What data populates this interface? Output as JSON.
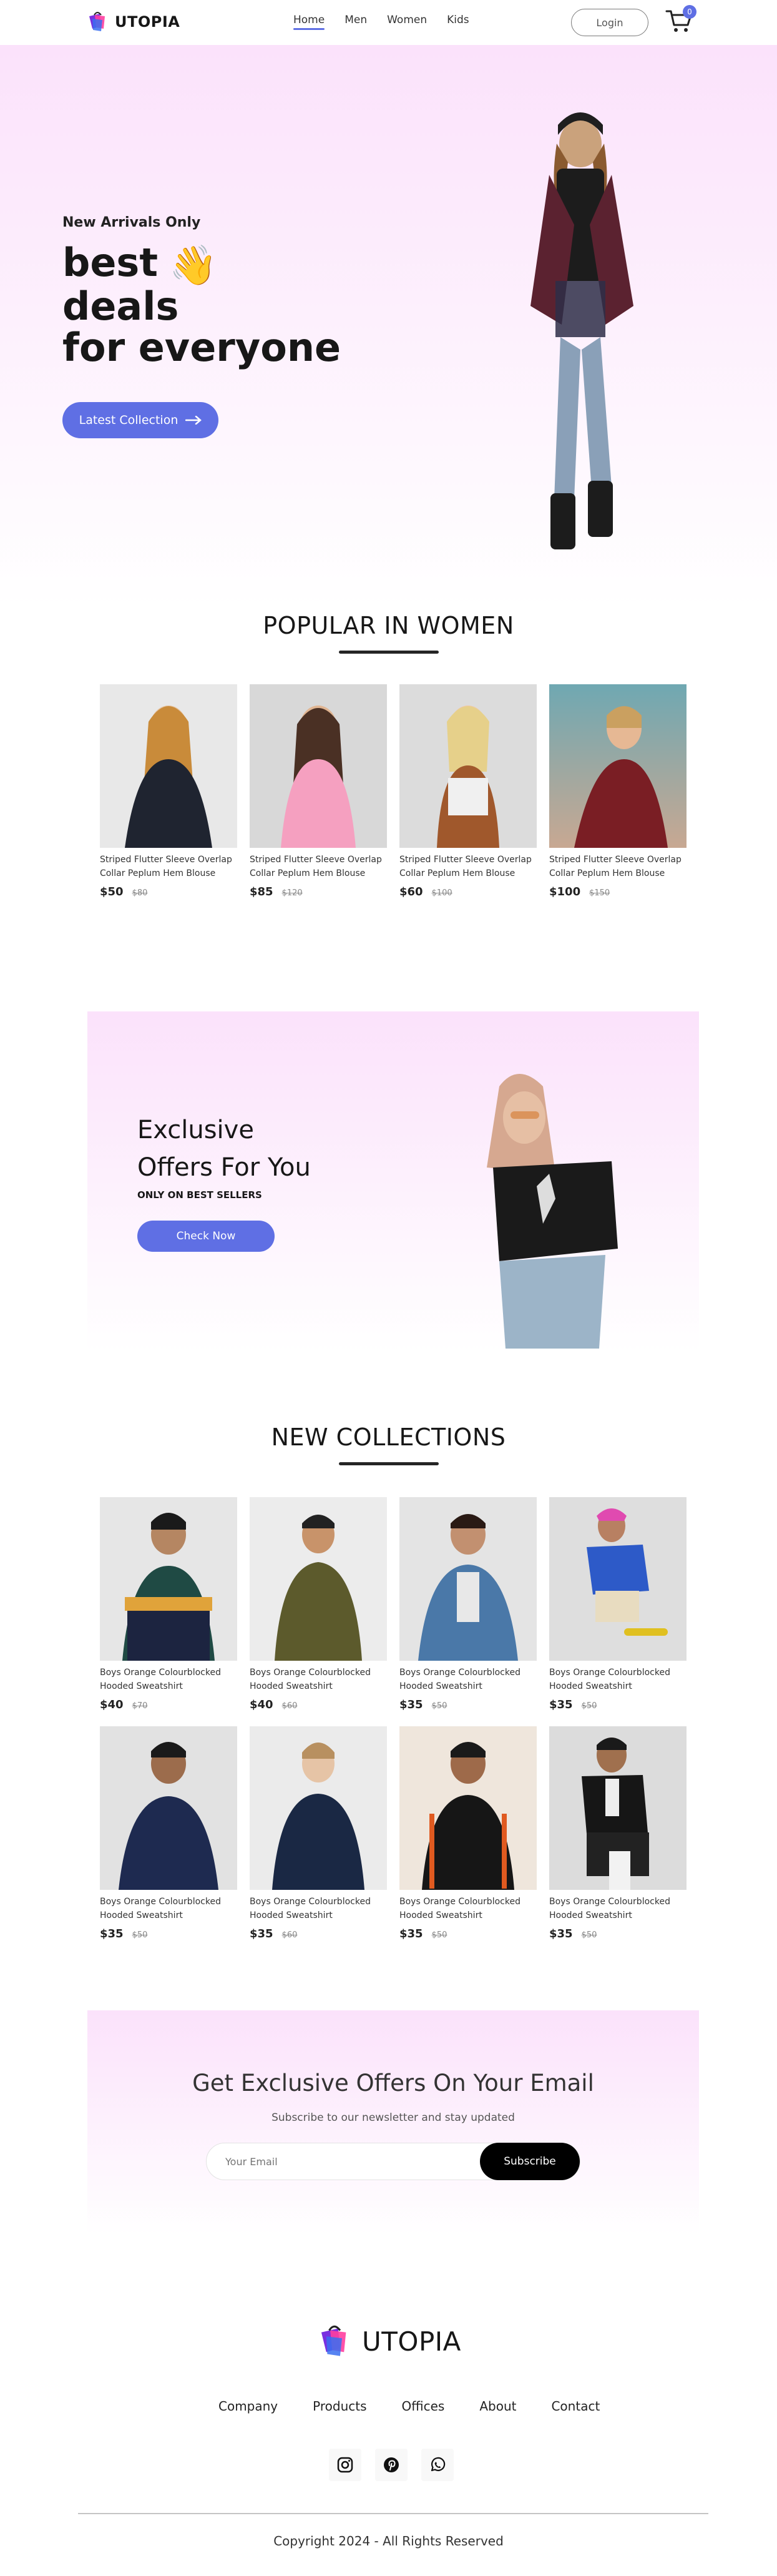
{
  "brand": {
    "name": "UTOPIA"
  },
  "nav": {
    "items": [
      {
        "label": "Home",
        "active": true
      },
      {
        "label": "Men",
        "active": false
      },
      {
        "label": "Women",
        "active": false
      },
      {
        "label": "Kids",
        "active": false
      }
    ],
    "login_label": "Login",
    "cart_count": "0"
  },
  "hero": {
    "tag": "New Arrivals Only",
    "line1": "best",
    "line2": "deals",
    "line3": "for everyone",
    "wave_icon": "👋",
    "button_label": "Latest Collection"
  },
  "popular": {
    "title": "POPULAR IN WOMEN",
    "products": [
      {
        "name": "Striped Flutter Sleeve Overlap Collar Peplum Hem Blouse",
        "price": "$50",
        "old_price": "$80"
      },
      {
        "name": "Striped Flutter Sleeve Overlap Collar Peplum Hem Blouse",
        "price": "$85",
        "old_price": "$120"
      },
      {
        "name": "Striped Flutter Sleeve Overlap Collar Peplum Hem Blouse",
        "price": "$60",
        "old_price": "$100"
      },
      {
        "name": "Striped Flutter Sleeve Overlap Collar Peplum Hem Blouse",
        "price": "$100",
        "old_price": "$150"
      }
    ]
  },
  "offer": {
    "line1": "Exclusive",
    "line2": "Offers For You",
    "sub": "ONLY ON BEST SELLERS",
    "button_label": "Check Now"
  },
  "collections": {
    "title": "NEW COLLECTIONS",
    "products": [
      {
        "name": "Boys Orange Colourblocked Hooded Sweatshirt",
        "price": "$40",
        "old_price": "$70"
      },
      {
        "name": "Boys Orange Colourblocked Hooded Sweatshirt",
        "price": "$40",
        "old_price": "$60"
      },
      {
        "name": "Boys Orange Colourblocked Hooded Sweatshirt",
        "price": "$35",
        "old_price": "$50"
      },
      {
        "name": "Boys Orange Colourblocked Hooded Sweatshirt",
        "price": "$35",
        "old_price": "$50"
      },
      {
        "name": "Boys Orange Colourblocked Hooded Sweatshirt",
        "price": "$35",
        "old_price": "$50"
      },
      {
        "name": "Boys Orange Colourblocked Hooded Sweatshirt",
        "price": "$35",
        "old_price": "$60"
      },
      {
        "name": "Boys Orange Colourblocked Hooded Sweatshirt",
        "price": "$35",
        "old_price": "$50"
      },
      {
        "name": "Boys Orange Colourblocked Hooded Sweatshirt",
        "price": "$35",
        "old_price": "$50"
      }
    ]
  },
  "newsletter": {
    "title": "Get Exclusive Offers On Your Email",
    "sub": "Subscribe to our newsletter and stay updated",
    "placeholder": "Your Email",
    "button_label": "Subscribe"
  },
  "footer": {
    "links": [
      "Company",
      "Products",
      "Offices",
      "About",
      "Contact"
    ],
    "socials": [
      "instagram-icon",
      "pinterest-icon",
      "whatsapp-icon"
    ],
    "copyright": "Copyright 2024 - All Rights Reserved"
  },
  "colors": {
    "accent": "#5f6fe4",
    "pink": "#fbe2fb",
    "dark": "#171717"
  }
}
